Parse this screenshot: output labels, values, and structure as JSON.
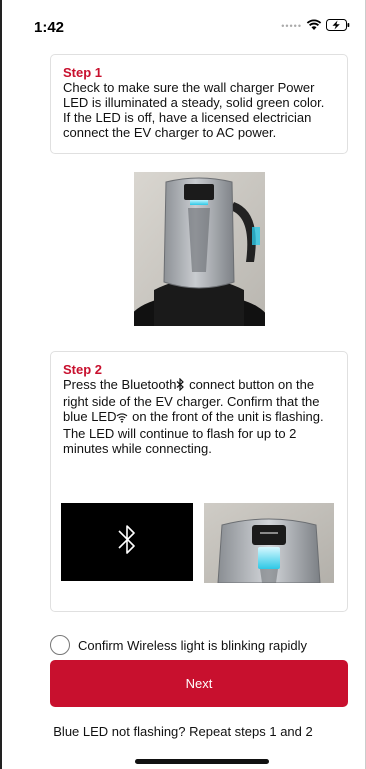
{
  "status_bar": {
    "time": "1:42"
  },
  "step1": {
    "title": "Step 1",
    "text": "Check to make sure the wall charger Power LED is illuminated a steady, solid green color. If the LED is off, have a licensed electrician connect the EV charger to AC power."
  },
  "step2": {
    "title": "Step 2",
    "text_part1": "Press the Bluetooth",
    "text_part2": " connect button on the right side of the EV charger. Confirm that the blue LED",
    "text_part3": " on the front of the unit is flashing. The LED will continue to flash for up to 2 minutes while connecting."
  },
  "confirm": {
    "label": "Confirm Wireless light is blinking rapidly"
  },
  "next_button": {
    "label": "Next"
  },
  "footer": {
    "repeat_text": "Blue LED not flashing? Repeat steps 1 and 2"
  },
  "colors": {
    "accent": "#c8102e",
    "led": "#2ec8e6"
  }
}
